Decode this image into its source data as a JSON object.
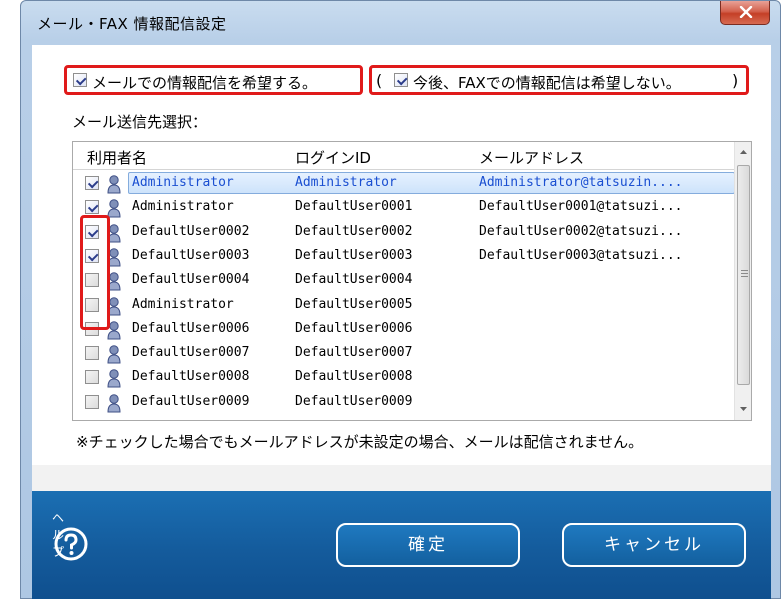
{
  "window": {
    "title": "メール・FAX 情報配信設定"
  },
  "options": {
    "email_delivery_label": "メールでの情報配信を希望する。",
    "email_delivery_checked": true,
    "paren_open": "(",
    "fax_label": "今後、FAXでの情報配信は希望しない。",
    "fax_checked": true,
    "paren_close": ")"
  },
  "recipient_section_label": "メール送信先選択：",
  "list": {
    "headers": [
      "利用者名",
      "ログインID",
      "メールアドレス"
    ],
    "rows": [
      {
        "name": "Administrator",
        "login": "Administrator",
        "mail": "Administrator@tatsuzin....",
        "checked": true,
        "selected": true
      },
      {
        "name": "Administrator",
        "login": "DefaultUser0001",
        "mail": "DefaultUser0001@tatsuzi...",
        "checked": true,
        "selected": false
      },
      {
        "name": "DefaultUser0002",
        "login": "DefaultUser0002",
        "mail": "DefaultUser0002@tatsuzi...",
        "checked": true,
        "selected": false
      },
      {
        "name": "DefaultUser0003",
        "login": "DefaultUser0003",
        "mail": "DefaultUser0003@tatsuzi...",
        "checked": true,
        "selected": false
      },
      {
        "name": "DefaultUser0004",
        "login": "DefaultUser0004",
        "mail": "",
        "checked": false,
        "selected": false
      },
      {
        "name": "Administrator",
        "login": "DefaultUser0005",
        "mail": "",
        "checked": false,
        "selected": false
      },
      {
        "name": "DefaultUser0006",
        "login": "DefaultUser0006",
        "mail": "",
        "checked": false,
        "selected": false
      },
      {
        "name": "DefaultUser0007",
        "login": "DefaultUser0007",
        "mail": "",
        "checked": false,
        "selected": false
      },
      {
        "name": "DefaultUser0008",
        "login": "DefaultUser0008",
        "mail": "",
        "checked": false,
        "selected": false
      },
      {
        "name": "DefaultUser0009",
        "login": "DefaultUser0009",
        "mail": "",
        "checked": false,
        "selected": false
      }
    ]
  },
  "note": "※チェックした場合でもメールアドレスが未設定の場合、メールは配信されません。",
  "footer": {
    "help_label": "ヘルプ",
    "ok_label": "確定",
    "cancel_label": "キャンセル"
  },
  "colors": {
    "highlight_red": "#e01a1a",
    "footer_blue": "#145b9c",
    "selected_text": "#1a4fd1"
  }
}
